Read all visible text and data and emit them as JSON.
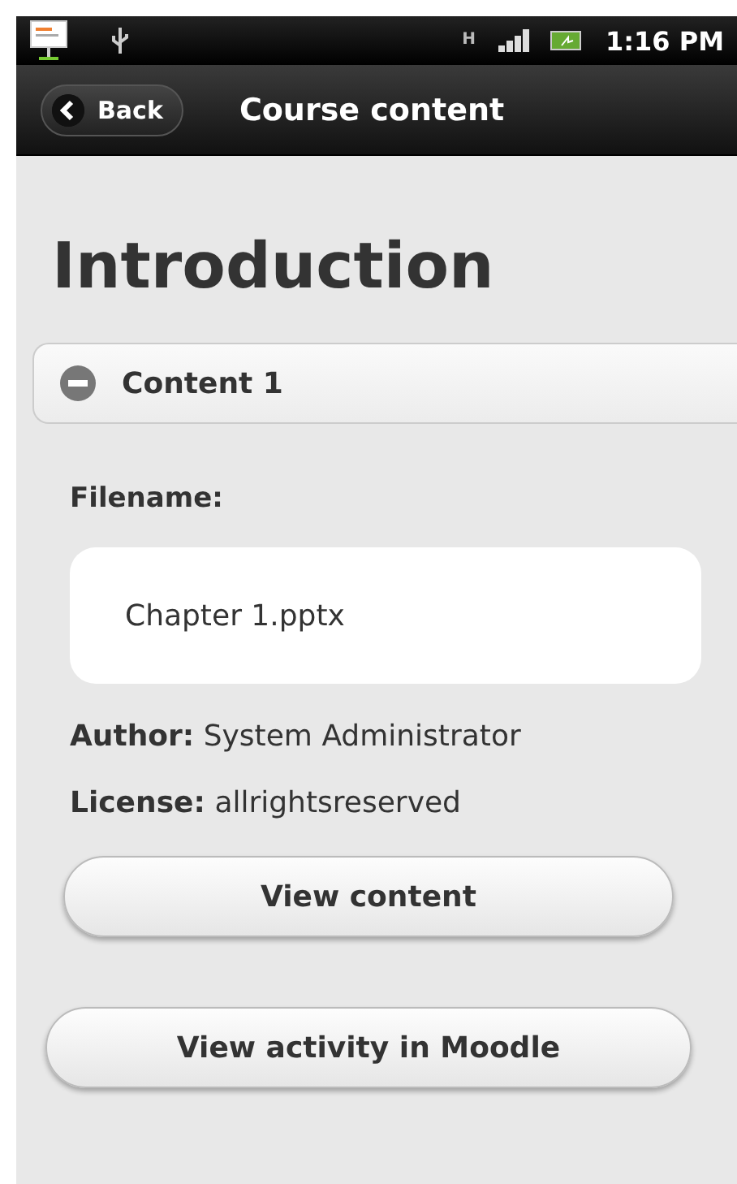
{
  "status_bar": {
    "time": "1:16 PM",
    "network_type": "H"
  },
  "header": {
    "back_label": "Back",
    "title": "Course content"
  },
  "page_title": "Introduction",
  "section": {
    "title": "Content 1",
    "expanded": true
  },
  "details": {
    "filename_label": "Filename:",
    "filename": "Chapter 1.pptx",
    "author_label": "Author:",
    "author": "System Administrator",
    "license_label": "License:",
    "license": "allrightsreserved"
  },
  "buttons": [
    {
      "label": "View content",
      "kind": "inset"
    },
    {
      "label": "View activity in Moodle",
      "kind": "wide"
    }
  ]
}
